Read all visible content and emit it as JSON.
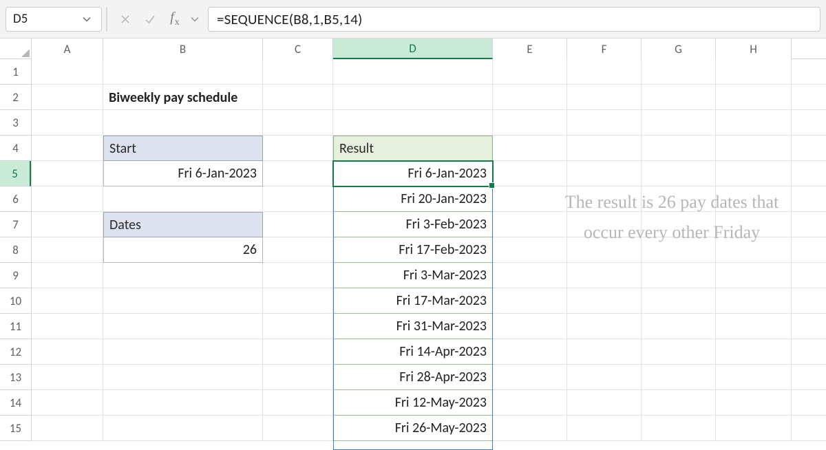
{
  "formula_bar": {
    "name_box": "D5",
    "formula": "=SEQUENCE(B8,1,B5,14)"
  },
  "columns": [
    "A",
    "B",
    "C",
    "D",
    "E",
    "F",
    "G",
    "H"
  ],
  "row_count": 15,
  "active_cell": "D5",
  "active_col": "D",
  "active_row": 5,
  "content": {
    "B2": "Biweekly pay schedule",
    "B4": "Start",
    "B5": "Fri 6-Jan-2023",
    "B7": "Dates",
    "B8": "26",
    "D4": "Result",
    "D5": "Fri 6-Jan-2023",
    "D6": "Fri 20-Jan-2023",
    "D7": "Fri 3-Feb-2023",
    "D8": "Fri 17-Feb-2023",
    "D9": "Fri 3-Mar-2023",
    "D10": "Fri 17-Mar-2023",
    "D11": "Fri 31-Mar-2023",
    "D12": "Fri 14-Apr-2023",
    "D13": "Fri 28-Apr-2023",
    "D14": "Fri 12-May-2023",
    "D15": "Fri 26-May-2023"
  },
  "annotation": "The result is 26 pay dates that occur every other Friday"
}
